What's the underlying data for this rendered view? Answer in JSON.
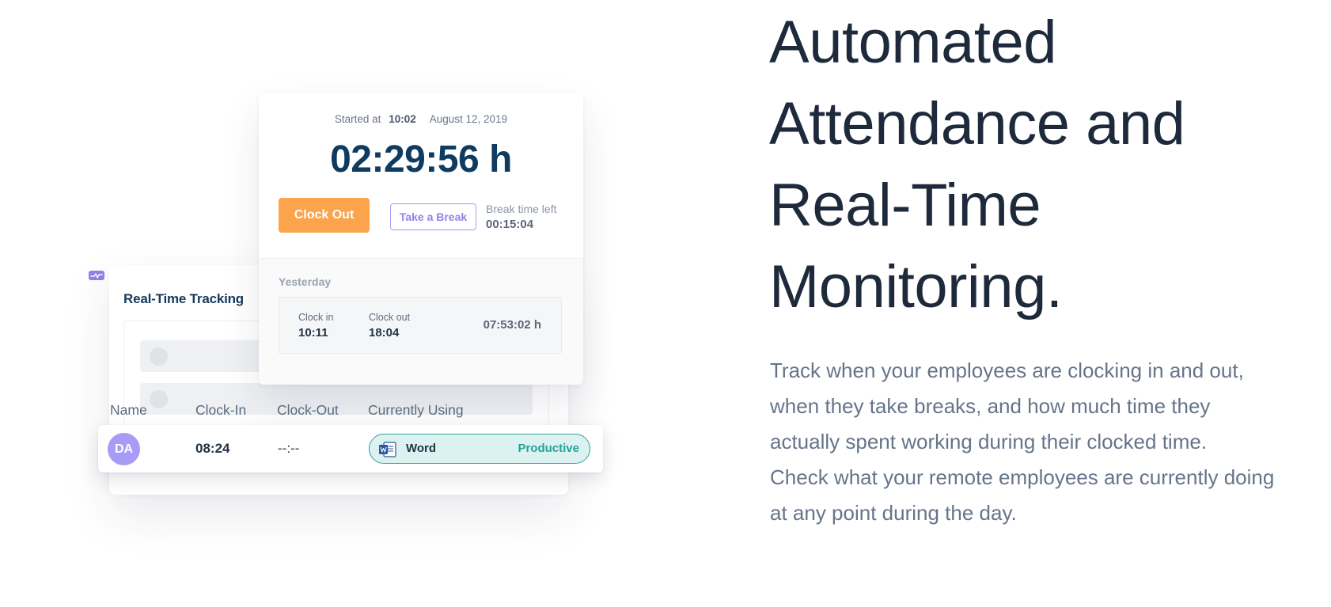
{
  "illustration": {
    "tracking": {
      "title": "Real-Time Tracking",
      "columns": [
        "Name",
        "Clock-In",
        "Clock-Out",
        "Currently Using"
      ],
      "row": {
        "initials": "DA",
        "clock_in": "08:24",
        "clock_out": "--:--",
        "app": "Word",
        "status": "Productive",
        "app_icon": "word-icon"
      }
    },
    "timer": {
      "started_label": "Started at",
      "started_time": "10:02",
      "started_date": "August 12, 2019",
      "elapsed": "02:29:56 h",
      "clock_out_label": "Clock Out",
      "break_label": "Take a Break",
      "break_left_label": "Break time left",
      "break_left_value": "00:15:04"
    },
    "yesterday": {
      "label": "Yesterday",
      "clock_in_label": "Clock in",
      "clock_in": "10:11",
      "clock_out_label": "Clock out",
      "clock_out": "18:04",
      "total": "07:53:02 h"
    }
  },
  "content": {
    "headline_lines": [
      "Automated",
      "Attendance and",
      "Real-Time",
      "Monitoring."
    ],
    "paragraphs": [
      "Track when your employees are clocking in and out, when they take breaks, and how much time they actually spent working during their clocked time.",
      "Check what your remote employees are currently doing at any point during the day."
    ]
  },
  "colors": {
    "accent_orange": "#fba44c",
    "accent_purple": "#a69bf2",
    "productive_teal": "#22a398",
    "heading": "#1e2a3b",
    "body_text": "#66748a",
    "timer_blue": "#0f3b61"
  }
}
